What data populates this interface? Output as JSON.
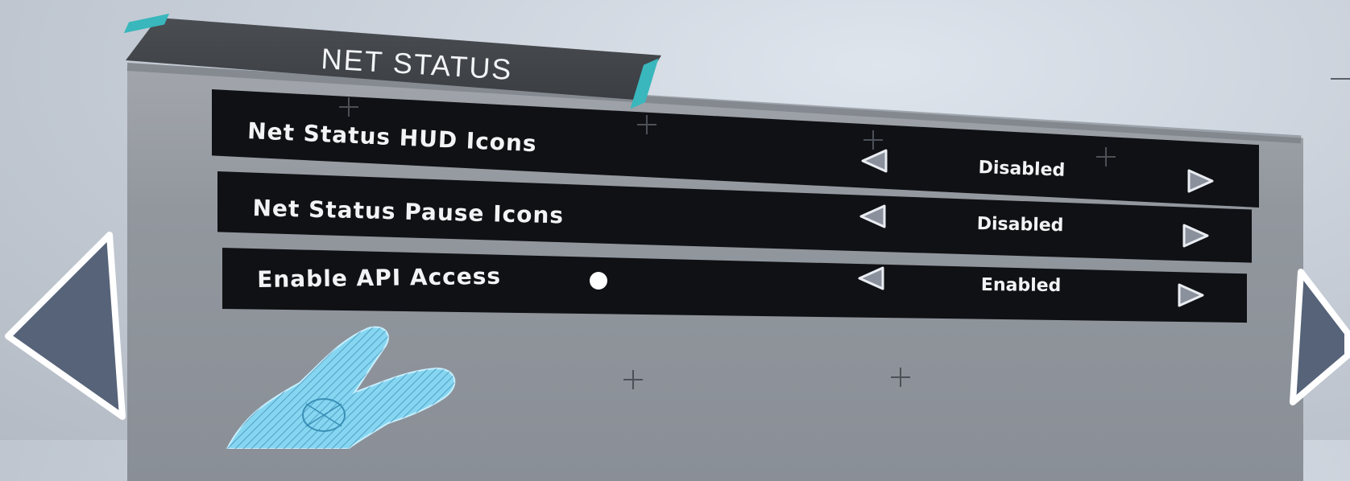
{
  "panel": {
    "title": "NET STATUS"
  },
  "settings": [
    {
      "label": "Net Status HUD Icons",
      "value": "Disabled"
    },
    {
      "label": "Net Status Pause Icons",
      "value": "Disabled"
    },
    {
      "label": "Enable API Access",
      "value": "Enabled"
    }
  ],
  "colors": {
    "background": "#c9d0d9",
    "panel": "#92979e",
    "row": "#101114",
    "accent": "#39b7bc",
    "nav_arrow_fill": "#566378",
    "hand": "#7fd3ef"
  },
  "icons": {
    "prev_value": "triangle-left-icon",
    "next_value": "triangle-right-icon",
    "prev_page": "large-triangle-left-icon",
    "next_page": "large-triangle-right-icon",
    "info": "dot-icon",
    "controller": "vr-hand-icon"
  }
}
